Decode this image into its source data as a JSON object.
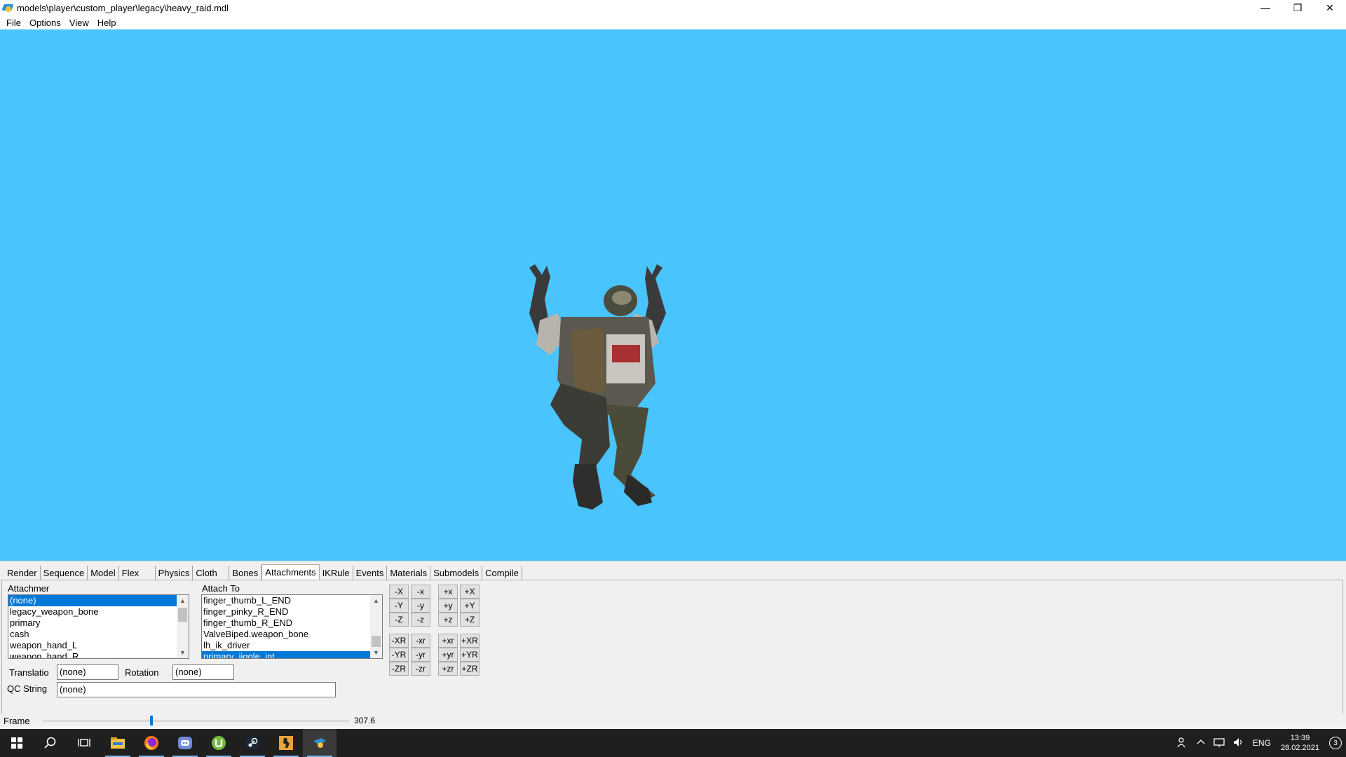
{
  "window": {
    "title": "models\\player\\custom_player\\legacy\\heavy_raid.mdl",
    "minimize": "—",
    "restore": "❐",
    "close": "✕"
  },
  "menu": [
    "File",
    "Options",
    "View",
    "Help"
  ],
  "viewport": {
    "background": "#4ac4fd"
  },
  "tabs": [
    {
      "label": "Render"
    },
    {
      "label": "Sequence"
    },
    {
      "label": "Model"
    },
    {
      "label": "Flex"
    },
    {
      "label": "Physics"
    },
    {
      "label": "Cloth"
    },
    {
      "label": "Bones"
    },
    {
      "label": "Attachments"
    },
    {
      "label": "IKRule"
    },
    {
      "label": "Events"
    },
    {
      "label": "Materials"
    },
    {
      "label": "Submodels"
    },
    {
      "label": "Compile"
    }
  ],
  "active_tab": "Attachments",
  "attachments": {
    "label": "Attachmer",
    "items": [
      "(none)",
      "legacy_weapon_bone",
      "primary",
      "cash",
      "weapon_hand_L",
      "weapon_hand_R"
    ],
    "selected": "(none)"
  },
  "attach_to": {
    "label": "Attach To",
    "items": [
      "finger_thumb_L_END",
      "finger_pinky_R_END",
      "finger_thumb_R_END",
      "ValveBiped.weapon_bone",
      "lh_ik_driver",
      "primary_jiggle_jnt"
    ],
    "selected": "primary_jiggle_jnt"
  },
  "translation": {
    "label": "Translatio",
    "value": "(none)"
  },
  "rotation": {
    "label": "Rotation",
    "value": "(none)"
  },
  "qc_string": {
    "label": "QC String",
    "value": "(none)"
  },
  "nudge_buttons": {
    "row1": [
      "-X",
      "-x",
      "+x",
      "+X"
    ],
    "row2": [
      "-Y",
      "-y",
      "+y",
      "+Y"
    ],
    "row3": [
      "-Z",
      "-z",
      "+z",
      "+Z"
    ],
    "row4": [
      "-XR",
      "-xr",
      "+xr",
      "+XR"
    ],
    "row5": [
      "-YR",
      "-yr",
      "+yr",
      "+YR"
    ],
    "row6": [
      "-ZR",
      "-zr",
      "+zr",
      "+ZR"
    ]
  },
  "frame": {
    "label": "Frame",
    "value": "307.6",
    "slider_fraction": 0.35
  },
  "taskbar": {
    "items": [
      "start-icon",
      "search-icon",
      "task-view-icon",
      "file-explorer-icon",
      "firefox-icon",
      "discord-icon",
      "utorrent-icon",
      "steam-icon",
      "csgo-icon",
      "hlmv-icon"
    ],
    "tray": {
      "lang": "ENG",
      "time": "13:39",
      "date": "28.02.2021",
      "notifications": "3"
    }
  }
}
